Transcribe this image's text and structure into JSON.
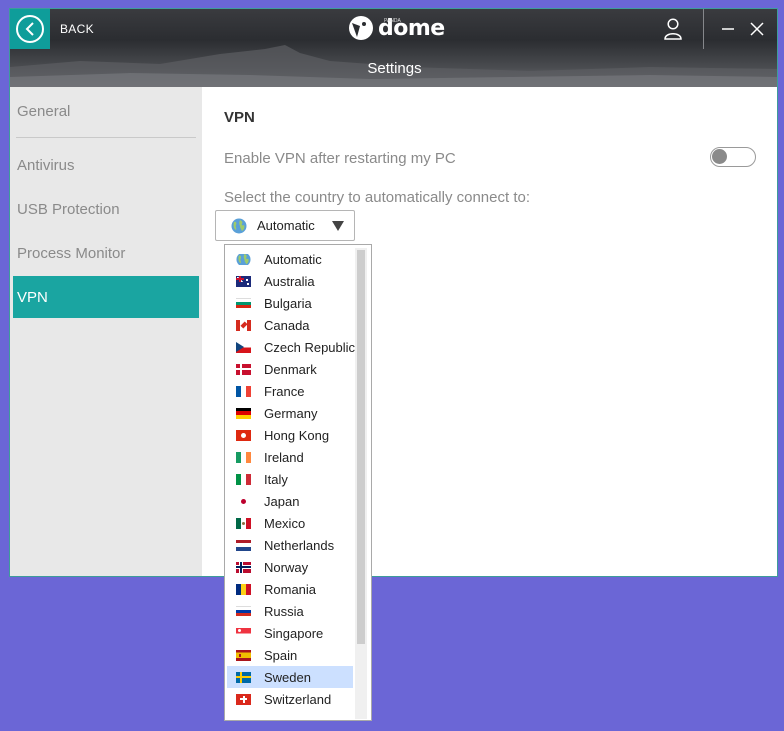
{
  "titlebar": {
    "back_label": "BACK",
    "logo_text": "dome",
    "logo_sup": "PANDA",
    "screen_title": "Settings"
  },
  "sidebar": {
    "items": [
      {
        "label": "General"
      },
      {
        "label": "Antivirus"
      },
      {
        "label": "USB Protection"
      },
      {
        "label": "Process Monitor"
      },
      {
        "label": "VPN",
        "active": true
      }
    ]
  },
  "vpn": {
    "title": "VPN",
    "restart_option": "Enable VPN after restarting my PC",
    "restart_enabled": false,
    "country_label": "Select the country to automatically connect to:",
    "selected_country": "Automatic"
  },
  "dropdown": {
    "highlighted": "Sweden",
    "items": [
      {
        "label": "Automatic",
        "icon": "globe-icon"
      },
      {
        "label": "Australia",
        "icon": "flag-australia-icon"
      },
      {
        "label": "Bulgaria",
        "icon": "flag-bulgaria-icon"
      },
      {
        "label": "Canada",
        "icon": "flag-canada-icon"
      },
      {
        "label": "Czech Republic",
        "icon": "flag-czech-icon"
      },
      {
        "label": "Denmark",
        "icon": "flag-denmark-icon"
      },
      {
        "label": "France",
        "icon": "flag-france-icon"
      },
      {
        "label": "Germany",
        "icon": "flag-germany-icon"
      },
      {
        "label": "Hong Kong",
        "icon": "flag-hongkong-icon"
      },
      {
        "label": "Ireland",
        "icon": "flag-ireland-icon"
      },
      {
        "label": "Italy",
        "icon": "flag-italy-icon"
      },
      {
        "label": "Japan",
        "icon": "flag-japan-icon"
      },
      {
        "label": "Mexico",
        "icon": "flag-mexico-icon"
      },
      {
        "label": "Netherlands",
        "icon": "flag-netherlands-icon"
      },
      {
        "label": "Norway",
        "icon": "flag-norway-icon"
      },
      {
        "label": "Romania",
        "icon": "flag-romania-icon"
      },
      {
        "label": "Russia",
        "icon": "flag-russia-icon"
      },
      {
        "label": "Singapore",
        "icon": "flag-singapore-icon"
      },
      {
        "label": "Spain",
        "icon": "flag-spain-icon"
      },
      {
        "label": "Sweden",
        "icon": "flag-sweden-icon"
      },
      {
        "label": "Switzerland",
        "icon": "flag-switzerland-icon"
      }
    ]
  },
  "colors": {
    "accent": "#1aa5a1",
    "background": "#6b66d6",
    "highlight": "#cce0ff"
  }
}
